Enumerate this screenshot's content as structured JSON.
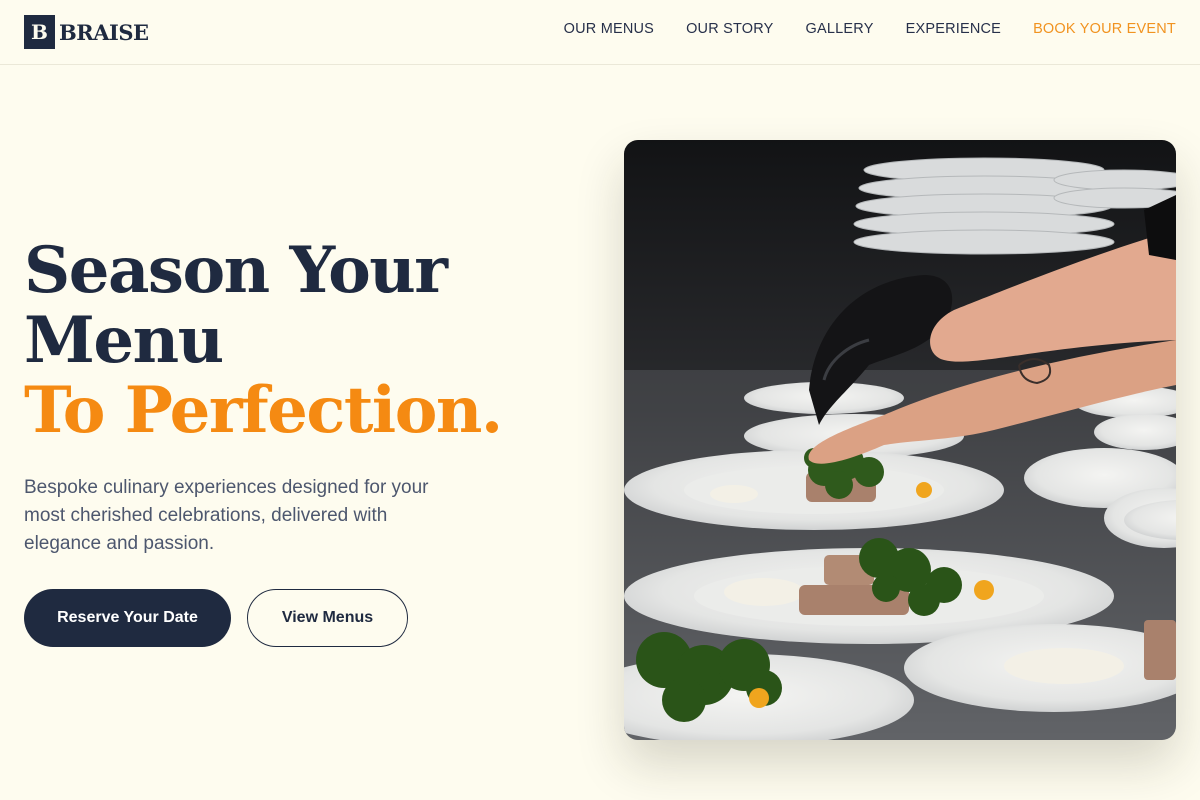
{
  "brand": {
    "mark": "B",
    "name": "BRAISE"
  },
  "nav": {
    "items": [
      "OUR MENUS",
      "OUR STORY",
      "GALLERY",
      "EXPERIENCE"
    ],
    "cta": "BOOK YOUR EVENT"
  },
  "hero": {
    "title_line1": "Season Your",
    "title_line2": "Menu",
    "title_accent": "To Perfection.",
    "description": "Bespoke culinary experiences designed for your most cherished celebrations, delivered with elegance and passion.",
    "primary_button": "Reserve Your Date",
    "secondary_button": "View Menus"
  },
  "colors": {
    "background": "#fefcef",
    "navy": "#1f2a40",
    "accent": "#f58a12",
    "nav_cta": "#f19320"
  }
}
